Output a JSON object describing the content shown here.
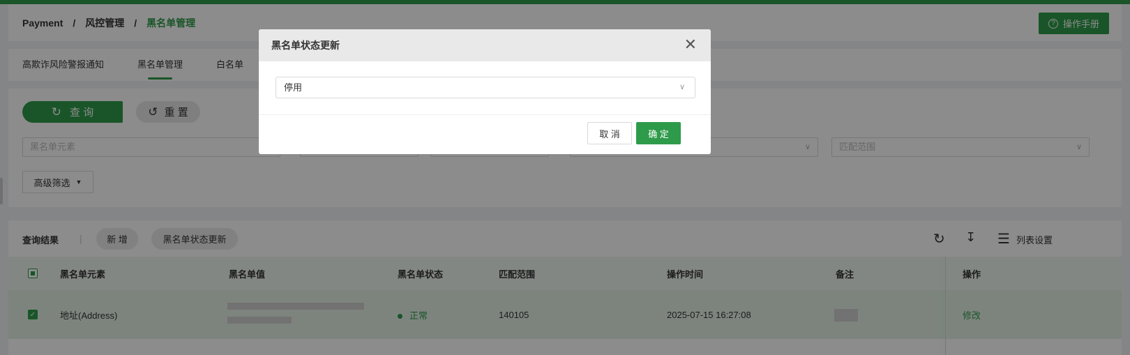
{
  "breadcrumb": {
    "items": [
      "Payment",
      "风控管理",
      "黑名单管理"
    ],
    "sep": "/"
  },
  "header": {
    "manual_label": "操作手册"
  },
  "tabs": [
    "高欺诈风险警报通知",
    "黑名单管理",
    "白名单"
  ],
  "filter": {
    "query_label": "查 询",
    "reset_label": "重 置",
    "element_placeholder": "黑名单元素",
    "match_placeholder": "匹配范围",
    "advanced_label": "高级筛选"
  },
  "results": {
    "title": "查询结果",
    "divider": "|",
    "add_label": "新 增",
    "status_update_label": "黑名单状态更新",
    "list_settings_label": "列表设置",
    "columns": [
      "黑名单元素",
      "黑名单值",
      "黑名单状态",
      "匹配范围",
      "操作时间",
      "备注",
      "操作"
    ],
    "rows": [
      {
        "element": "地址(Address)",
        "status": "正常",
        "match": "140105",
        "time": "2025-07-15 16:27:08",
        "action": "修改"
      }
    ]
  },
  "modal": {
    "title": "黑名单状态更新",
    "select_value": "停用",
    "cancel_label": "取 消",
    "ok_label": "确 定"
  }
}
